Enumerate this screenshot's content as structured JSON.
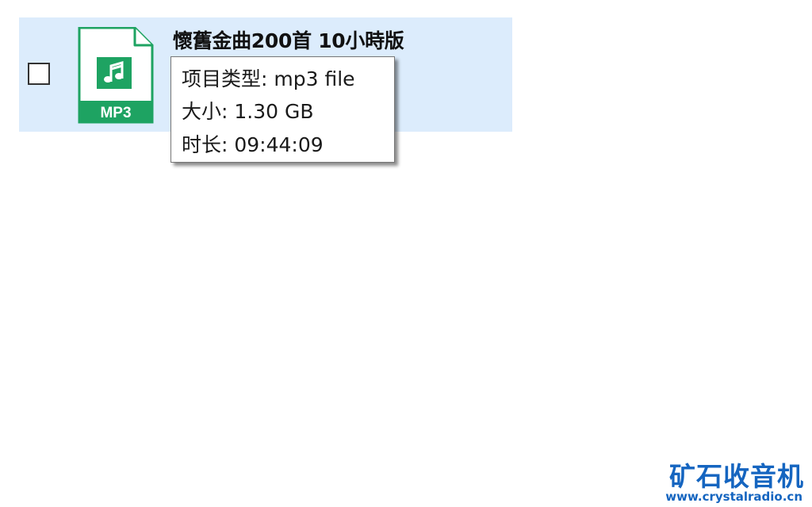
{
  "file": {
    "name": "懷舊金曲200首 10小時版",
    "icon_label": "MP3",
    "icon": "mp3-file-icon",
    "selected": false
  },
  "tooltip": {
    "type_line": "项目类型: mp3 file",
    "size_line": "大小: 1.30 GB",
    "duration_line": "时长: 09:44:09"
  },
  "watermark": {
    "title": "矿石收音机",
    "url": "www.crystalradio.cn"
  },
  "colors": {
    "row_highlight": "#dcecfc",
    "icon_green": "#1ea362",
    "watermark_blue": "#1565c0"
  }
}
